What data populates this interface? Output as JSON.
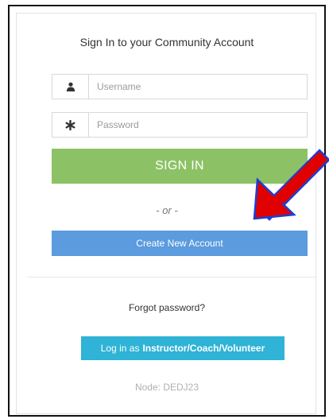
{
  "login_panel": {
    "title": "Sign In to your Community Account",
    "username_placeholder": "Username",
    "password_placeholder": "Password",
    "signin_label": "SIGN IN",
    "or_text": "- or -",
    "create_account_label": "Create New Account",
    "forgot_password_label": "Forgot password?",
    "instructor_prefix": "Log in as",
    "instructor_bold": "Instructor/Coach/Volunteer",
    "node_text": "Node: DEDJ23"
  },
  "icons": {
    "username": "user-icon",
    "password": "asterisk-icon",
    "annotation": "red-arrow-icon"
  },
  "colors": {
    "signin": "#8cc265",
    "create_account": "#5b9bde",
    "instructor": "#2fb3d6",
    "arrow": "#e00000"
  }
}
